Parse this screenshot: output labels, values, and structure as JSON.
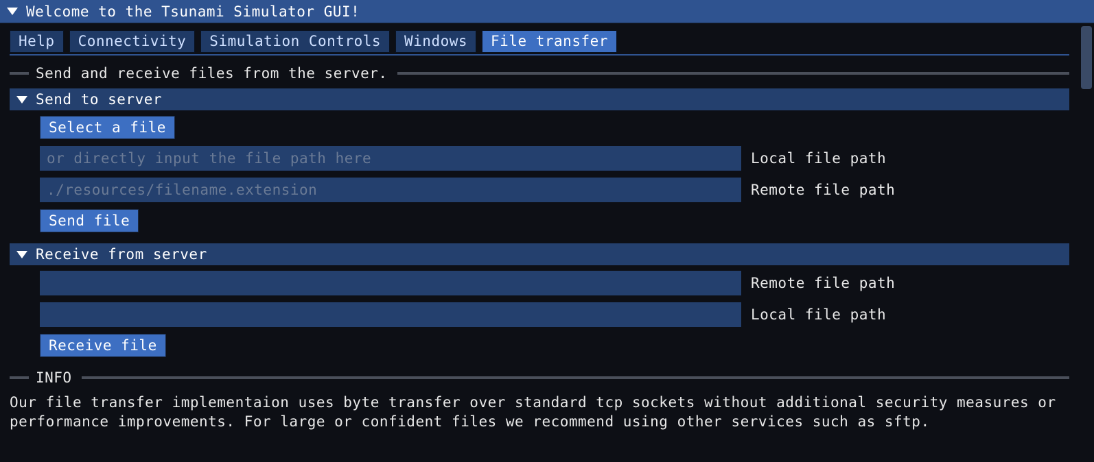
{
  "window": {
    "title": "Welcome to the Tsunami Simulator GUI!"
  },
  "tabs": [
    {
      "label": "Help",
      "active": false
    },
    {
      "label": "Connectivity",
      "active": false
    },
    {
      "label": "Simulation Controls",
      "active": false
    },
    {
      "label": "Windows",
      "active": false
    },
    {
      "label": "File transfer",
      "active": true
    }
  ],
  "section": {
    "description": "Send and receive files from the server."
  },
  "send": {
    "header": "Send to server",
    "select_button": "Select a file",
    "local_placeholder": "or directly input the file path here",
    "local_label": "Local file path",
    "remote_placeholder": "./resources/filename.extension",
    "remote_label": "Remote file path",
    "send_button": "Send file"
  },
  "receive": {
    "header": "Receive from server",
    "remote_label": "Remote file path",
    "local_label": "Local file path",
    "receive_button": "Receive file"
  },
  "info": {
    "header": "INFO",
    "body": "Our file transfer implementaion uses byte transfer over standard tcp sockets without additional security measures or performance improvements. For large or confident files we recommend using other services such as sftp."
  }
}
